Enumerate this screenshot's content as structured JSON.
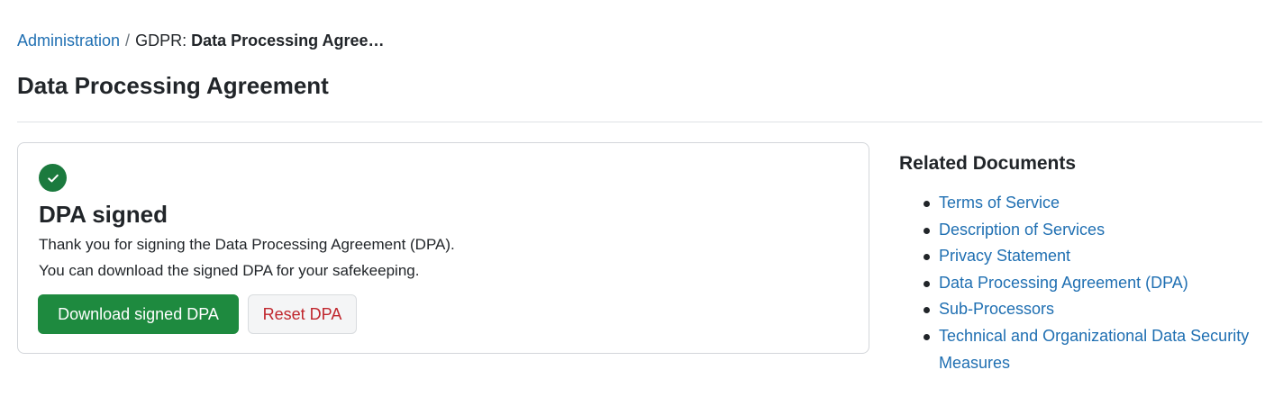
{
  "breadcrumb": {
    "root": "Administration",
    "separator": "/",
    "current_prefix": "GDPR:",
    "current_bold": "Data Processing Agree…"
  },
  "page_title": "Data Processing Agreement",
  "card": {
    "icon": "check-circle-icon",
    "title": "DPA signed",
    "line1": "Thank you for signing the Data Processing Agreement (DPA).",
    "line2": "You can download the signed DPA for your safekeeping.",
    "download_button": "Download signed DPA",
    "reset_button": "Reset DPA"
  },
  "related": {
    "title": "Related Documents",
    "items": [
      {
        "label": "Terms of Service"
      },
      {
        "label": "Description of Services"
      },
      {
        "label": "Privacy Statement"
      },
      {
        "label": "Data Processing Agreement (DPA)"
      },
      {
        "label": "Sub-Processors"
      },
      {
        "label": "Technical and Organizational Data Security Measures"
      }
    ]
  },
  "colors": {
    "link": "#1f6fb2",
    "success": "#1e8a3f",
    "danger": "#c0262d"
  }
}
